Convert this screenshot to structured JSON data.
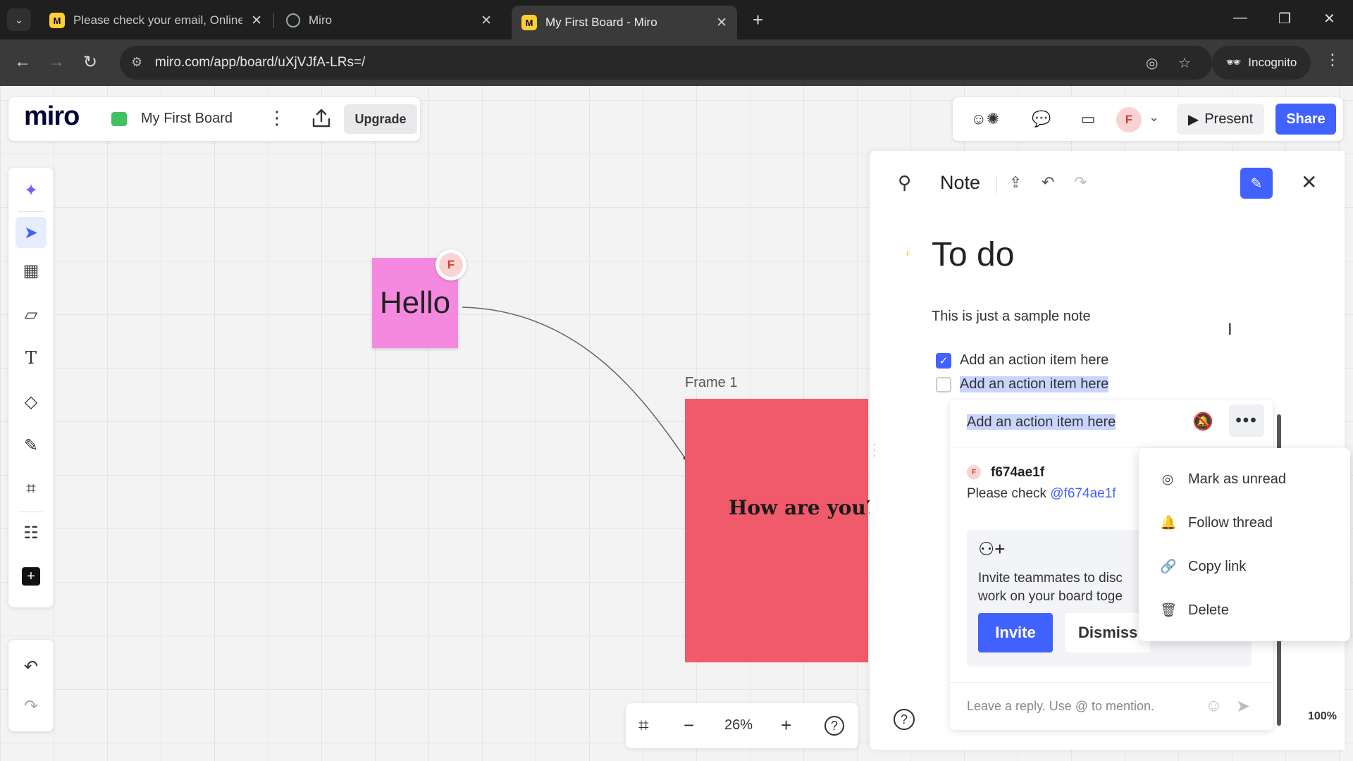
{
  "browser": {
    "tabs": [
      {
        "title": "Please check your email, Online",
        "favicon": "miro-icon"
      },
      {
        "title": "Miro",
        "favicon": "globe-icon"
      },
      {
        "title": "My First Board - Miro",
        "favicon": "miro-icon",
        "active": true
      }
    ],
    "url": "miro.com/app/board/uXjVJfA-LRs=/",
    "incognito_label": "Incognito"
  },
  "header": {
    "logo": "miro",
    "board_name": "My First Board",
    "upgrade_label": "Upgrade",
    "user_initial": "F",
    "present_label": "Present",
    "share_label": "Share"
  },
  "board": {
    "sticky_text": "Hello",
    "sticky_author": "F",
    "frame_label": "Frame 1",
    "frame_text": "How are you?",
    "zoom": "26%"
  },
  "note_panel": {
    "title": "Note",
    "note_title": "To do",
    "body": "This is just a sample note",
    "author_initial": "F",
    "action_items": [
      {
        "text": "Add an action item here",
        "checked": true
      },
      {
        "text": "Add an action item here",
        "checked": false
      }
    ],
    "zoom": "100%"
  },
  "comment_thread": {
    "header": "Add an action item here",
    "user_initial": "F",
    "user": "f674ae1f",
    "message_prefix": "Please check ",
    "mention": "@f674ae1f",
    "invite_text_line1": "Invite teammates to disc",
    "invite_text_line2": "work on your board toge",
    "invite_label": "Invite",
    "dismiss_label": "Dismiss",
    "reply_placeholder": "Leave a reply. Use @ to mention."
  },
  "context_menu": {
    "items": [
      {
        "label": "Mark as unread",
        "icon": "unread-icon"
      },
      {
        "label": "Follow thread",
        "icon": "bell-icon"
      },
      {
        "label": "Copy link",
        "icon": "link-icon"
      },
      {
        "label": "Delete",
        "icon": "trash-icon"
      }
    ]
  },
  "colors": {
    "accent": "#4262ff",
    "sticky": "#f589e0",
    "frame": "#f05a6b"
  }
}
